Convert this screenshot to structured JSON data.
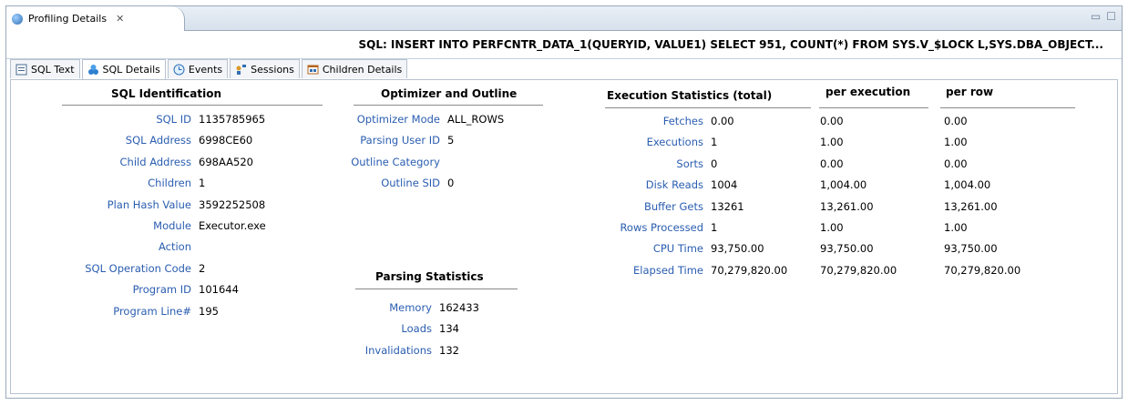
{
  "view_tab": {
    "title": "Profiling Details",
    "close": "✕"
  },
  "window_controls": {
    "minimize": "▭",
    "maximize": "☐"
  },
  "sql_header": "SQL: INSERT INTO PERFCNTR_DATA_1(QUERYID, VALUE1) SELECT 951, COUNT(*) FROM SYS.V_$LOCK L,SYS.DBA_OBJECT...",
  "tabs": [
    {
      "label": "SQL Text",
      "icon": "sql-text-icon"
    },
    {
      "label": "SQL Details",
      "icon": "sql-details-icon",
      "active": true
    },
    {
      "label": "Events",
      "icon": "events-icon"
    },
    {
      "label": "Sessions",
      "icon": "sessions-icon"
    },
    {
      "label": "Children Details",
      "icon": "children-details-icon"
    }
  ],
  "sql_identification": {
    "title": "SQL Identification",
    "rows": [
      {
        "label": "SQL ID",
        "value": "1135785965"
      },
      {
        "label": "SQL Address",
        "value": "6998CE60"
      },
      {
        "label": "Child Address",
        "value": "698AA520"
      },
      {
        "label": "Children",
        "value": "1"
      },
      {
        "label": "Plan Hash Value",
        "value": "3592252508"
      },
      {
        "label": "Module",
        "value": "Executor.exe"
      },
      {
        "label": "Action",
        "value": ""
      },
      {
        "label": "SQL Operation Code",
        "value": "2"
      },
      {
        "label": "Program ID",
        "value": "101644"
      },
      {
        "label": "Program Line#",
        "value": "195"
      }
    ]
  },
  "optimizer": {
    "title": "Optimizer and Outline",
    "rows": [
      {
        "label": "Optimizer Mode",
        "value": "ALL_ROWS"
      },
      {
        "label": "Parsing User ID",
        "value": "5"
      },
      {
        "label": "Outline Category",
        "value": ""
      },
      {
        "label": "Outline SID",
        "value": "0"
      }
    ]
  },
  "parsing": {
    "title": "Parsing Statistics",
    "rows": [
      {
        "label": "Memory",
        "value": "162433"
      },
      {
        "label": "Loads",
        "value": "134"
      },
      {
        "label": "Invalidations",
        "value": "132"
      }
    ]
  },
  "execution": {
    "title": "Execution Statistics (total)",
    "col_per_exec": "per execution",
    "col_per_row": "per row",
    "rows": [
      {
        "label": "Fetches",
        "total": "0.00",
        "per_exec": "0.00",
        "per_row": "0.00"
      },
      {
        "label": "Executions",
        "total": "1",
        "per_exec": "1.00",
        "per_row": "1.00"
      },
      {
        "label": "Sorts",
        "total": "0",
        "per_exec": "0.00",
        "per_row": "0.00"
      },
      {
        "label": "Disk Reads",
        "total": "1004",
        "per_exec": "1,004.00",
        "per_row": "1,004.00"
      },
      {
        "label": "Buffer Gets",
        "total": "13261",
        "per_exec": "13,261.00",
        "per_row": "13,261.00"
      },
      {
        "label": "Rows Processed",
        "total": "1",
        "per_exec": "1.00",
        "per_row": "1.00"
      },
      {
        "label": "CPU Time",
        "total": "93,750.00",
        "per_exec": "93,750.00",
        "per_row": "93,750.00"
      },
      {
        "label": "Elapsed Time",
        "total": "70,279,820.00",
        "per_exec": "70,279,820.00",
        "per_row": "70,279,820.00"
      }
    ]
  }
}
